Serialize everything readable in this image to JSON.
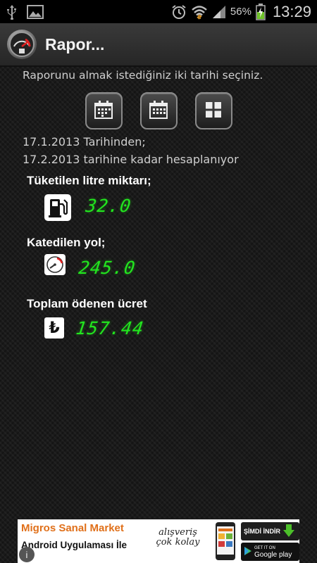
{
  "status_bar": {
    "battery_percent": "56%",
    "time": "13:29",
    "icons": [
      "usb-icon",
      "image-icon",
      "alarm-icon",
      "wifi-icon",
      "signal-icon",
      "battery-charging-icon"
    ]
  },
  "action_bar": {
    "title": "Rapor...",
    "app_icon": "fuel-gauge-icon"
  },
  "report": {
    "instruction": "Raporunu almak istediğiniz iki tarihi seçiniz.",
    "buttons": [
      {
        "icon": "calendar-icon",
        "purpose": "start-date"
      },
      {
        "icon": "calendar-icon",
        "purpose": "end-date"
      },
      {
        "icon": "grid-icon",
        "purpose": "calculate"
      }
    ],
    "from_line": "17.1.2013 Tarihinden;",
    "to_line": "17.2.2013 tarihine kadar hesaplanıyor"
  },
  "stats": {
    "fuel": {
      "label": "Tüketilen litre miktarı;",
      "value": "32.0",
      "icon": "fuel-pump-icon"
    },
    "distance": {
      "label": "Katedilen yol;",
      "value": "245.0",
      "icon": "speedometer-icon"
    },
    "cost": {
      "label": "Toplam ödenen ücret",
      "value": "157.44",
      "icon": "turkish-lira-icon",
      "symbol": "₺"
    }
  },
  "ad": {
    "brand": "Migros Sanal Market",
    "subtitle": "Android Uygulaması İle",
    "slogan_line1": "alışveriş",
    "slogan_line2": "çok kolay",
    "download_label": "ŞİMDİ İNDİR",
    "store_top": "GET IT ON",
    "store_label": "Google play",
    "info_glyph": "i"
  },
  "colors": {
    "digital_green": "#22e61f",
    "label_white": "#ffffff",
    "background": "#1a1a1a",
    "brand_orange": "#e0701a"
  }
}
